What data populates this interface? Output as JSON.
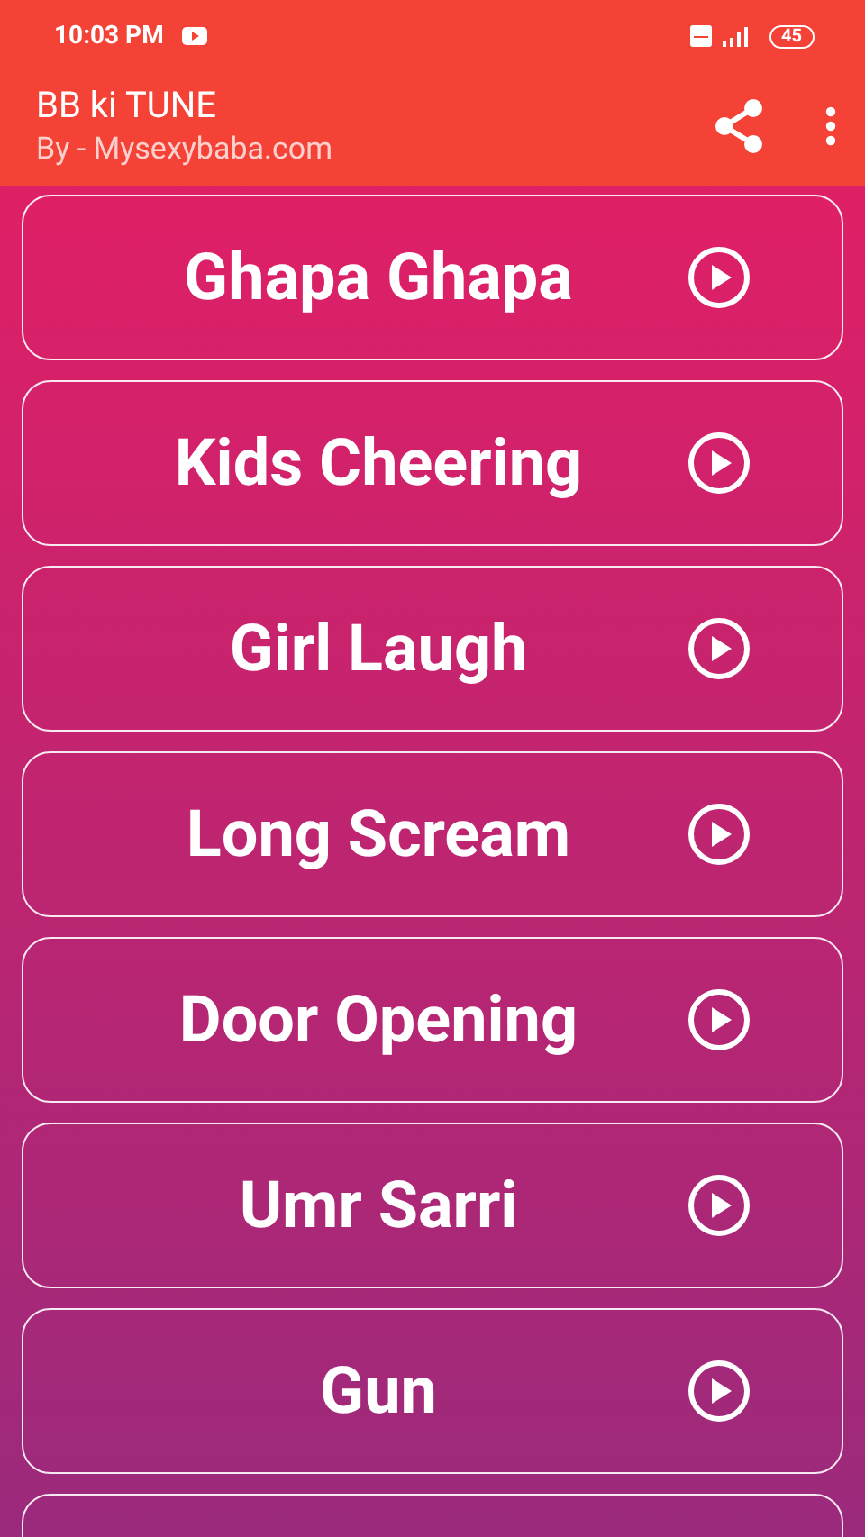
{
  "status_bar": {
    "time": "10:03 PM",
    "battery": "45"
  },
  "app_bar": {
    "title": "BB ki TUNE",
    "subtitle": "By - Mysexybaba.com"
  },
  "sounds": [
    {
      "label": "Ghapa Ghapa"
    },
    {
      "label": "Kids Cheering"
    },
    {
      "label": "Girl Laugh"
    },
    {
      "label": "Long Scream"
    },
    {
      "label": "Door Opening"
    },
    {
      "label": "Umr Sarri"
    },
    {
      "label": "Gun"
    }
  ]
}
